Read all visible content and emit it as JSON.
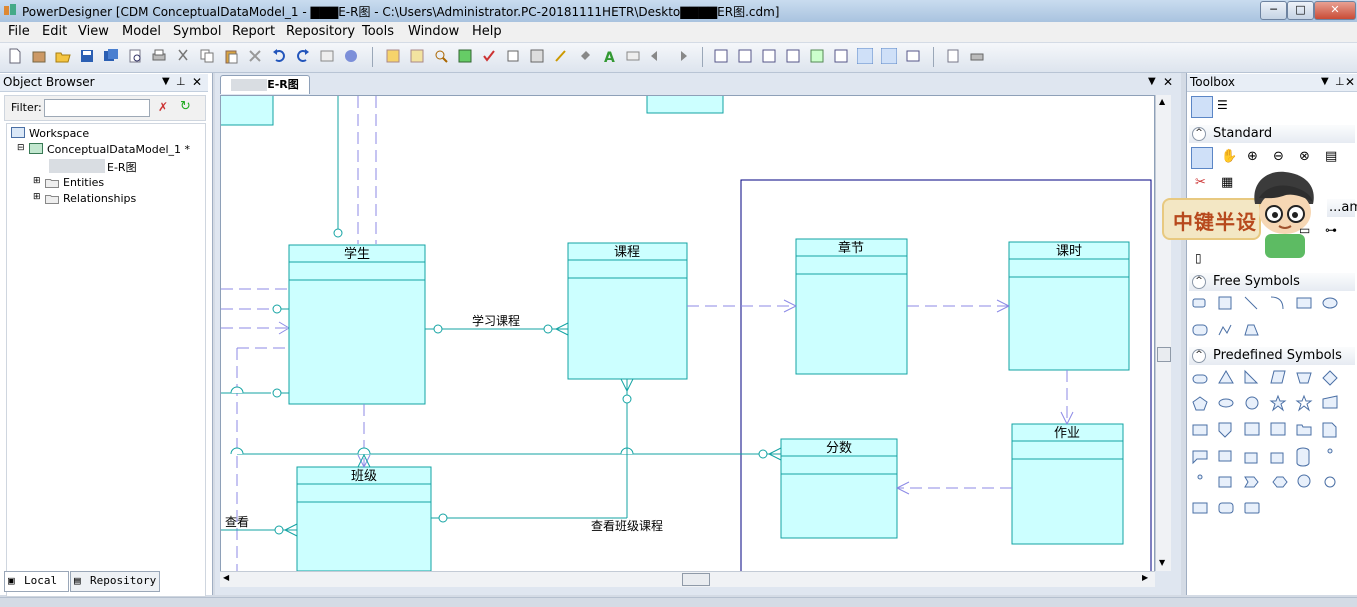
{
  "window": {
    "title": "PowerDesigner [CDM ConceptualDataModel_1 - ▇▇▇E-R图 - C:\\Users\\Administrator.PC-20181111HETR\\Deskto▇▇▇▇ER图.cdm]",
    "minimize": "─",
    "maximize": "□",
    "close": "✕"
  },
  "menu": [
    "File",
    "Edit",
    "View",
    "Model",
    "Symbol",
    "Report",
    "Repository",
    "Tools",
    "Window",
    "Help"
  ],
  "object_browser": {
    "title": "Object Browser",
    "filter_label": "Filter:",
    "filter_value": "",
    "tree": {
      "workspace": "Workspace",
      "model": "ConceptualDataModel_1 *",
      "diagram": "E-R图",
      "entities": "Entities",
      "relationships": "Relationships"
    },
    "tabs": {
      "local": "Local",
      "repository": "Repository"
    }
  },
  "document": {
    "tab_label": "E-R图",
    "entities": {
      "student": "学生",
      "course": "课程",
      "chapter": "章节",
      "lesson": "课时",
      "class": "班级",
      "score": "分数",
      "homework": "作业"
    },
    "relationships": {
      "study_course": "学习课程",
      "view": "查看",
      "view_class_course": "查看班级课程"
    }
  },
  "toolbox": {
    "title": "Toolbox",
    "sections": {
      "standard": "Standard",
      "diagram": "...am",
      "free_symbols": "Free Symbols",
      "predefined_symbols": "Predefined Symbols"
    },
    "watermark_text": "中键半设"
  },
  "colors": {
    "entity_fill": "#ccffff",
    "entity_stroke": "#13a3a3",
    "inheritance_dash": "#8c8ae6",
    "package_border": "#000080"
  }
}
